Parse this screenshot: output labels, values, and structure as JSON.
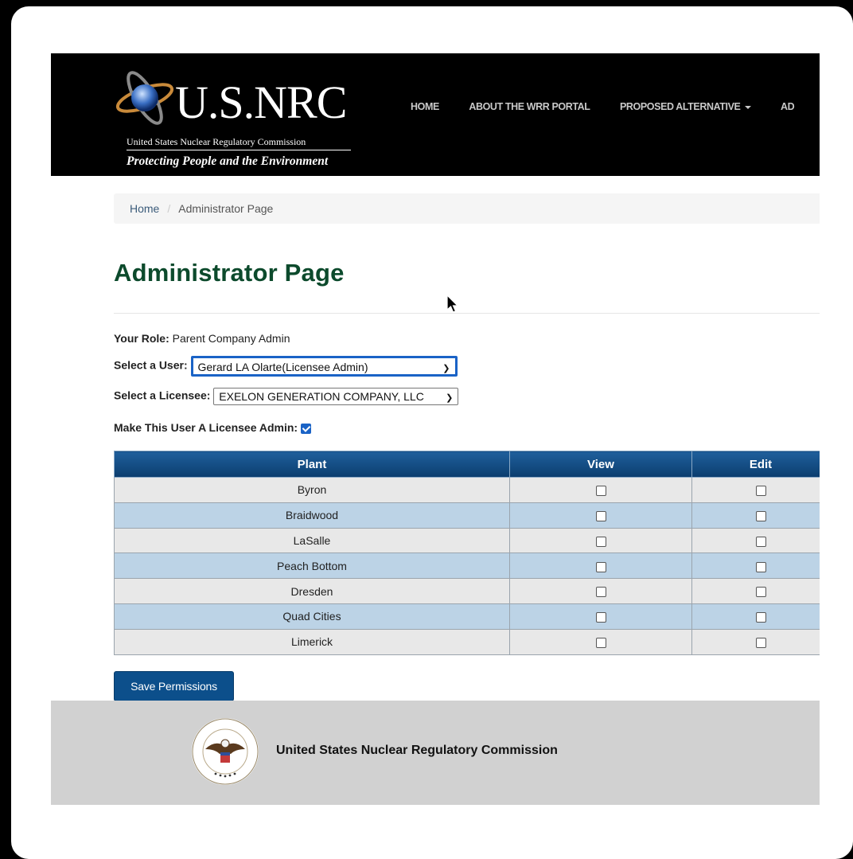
{
  "header": {
    "logo_wordmark": "U.S.NRC",
    "logo_subtitle": "United States Nuclear Regulatory Commission",
    "logo_tagline": "Protecting People and the Environment",
    "nav": {
      "home": "HOME",
      "about": "ABOUT THE WRR PORTAL",
      "proposed": "PROPOSED ALTERNATIVE",
      "cut": "AD"
    }
  },
  "breadcrumb": {
    "home": "Home",
    "separator": "/",
    "current": "Administrator Page"
  },
  "page_title": "Administrator Page",
  "form": {
    "role_label": "Your Role:",
    "role_value": "Parent Company Admin",
    "user_label": "Select a User:",
    "user_selected": "Gerard LA Olarte(Licensee Admin)",
    "licensee_label": "Select a Licensee:",
    "licensee_selected": "EXELON GENERATION COMPANY, LLC",
    "admin_label": "Make This User A Licensee Admin:",
    "admin_checked": true
  },
  "table": {
    "headers": [
      "Plant",
      "View",
      "Edit"
    ],
    "rows": [
      {
        "plant": "Byron",
        "view": false,
        "edit": false
      },
      {
        "plant": "Braidwood",
        "view": false,
        "edit": false
      },
      {
        "plant": "LaSalle",
        "view": false,
        "edit": false
      },
      {
        "plant": "Peach Bottom",
        "view": false,
        "edit": false
      },
      {
        "plant": "Dresden",
        "view": false,
        "edit": false
      },
      {
        "plant": "Quad Cities",
        "view": false,
        "edit": false
      },
      {
        "plant": "Limerick",
        "view": false,
        "edit": false
      }
    ]
  },
  "save_button": "Save Permissions",
  "footer": {
    "title": "United States Nuclear Regulatory Commission"
  },
  "colors": {
    "header_bg": "#000000",
    "title_green": "#0c4a2c",
    "table_header": "#1f5f9c",
    "row_even": "#bcd3e6",
    "row_odd": "#e8e8e8",
    "button": "#0c4f8b",
    "focus_blue": "#1a63c6"
  },
  "icons": [
    "atom-logo-icon",
    "chevron-down-icon",
    "caret-down-icon",
    "checkbox-icon",
    "nrc-seal-icon",
    "mouse-cursor-icon"
  ]
}
